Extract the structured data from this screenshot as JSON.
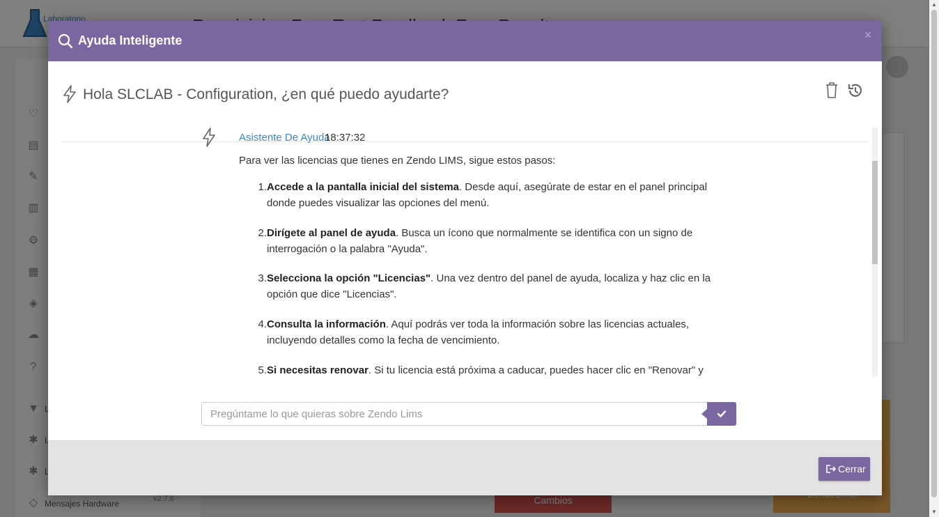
{
  "background": {
    "logo_text": "Laboratorio",
    "page_title": "Requisicion Free Test Feedback Free Result",
    "sidebar_items": [
      "L",
      "L",
      "L",
      "Mensajes Hardware"
    ],
    "version": "v2.7.6",
    "bottom_buttons": [
      "Cambios",
      "ZendoLims"
    ]
  },
  "modal": {
    "title": "Ayuda Inteligente",
    "close_glyph": "×",
    "greeting": "Hola SLCLAB - Configuration, ¿en qué puedo ayudarte?",
    "message": {
      "author": "Asistente De Ayuda",
      "time": "18:37:32",
      "intro": "Para ver las licencias que tienes en Zendo LIMS, sigue estos pasos:",
      "steps": [
        {
          "num": "1.",
          "bold": "Accede a la pantalla inicial del sistema",
          "text": ". Desde aquí, asegúrate de estar en el panel principal donde puedes visualizar las opciones del menú."
        },
        {
          "num": "2.",
          "bold": "Dirígete al panel de ayuda",
          "text": ". Busca un ícono que normalmente se identifica con un signo de interrogación o la palabra \"Ayuda\"."
        },
        {
          "num": "3.",
          "bold": "Selecciona la opción \"Licencias\"",
          "text": ". Una vez dentro del panel de ayuda, localiza y haz clic en la opción que dice \"Licencias\"."
        },
        {
          "num": "4.",
          "bold": "Consulta la información",
          "text": ". Aquí podrás ver toda la información sobre las licencias actuales, incluyendo detalles como la fecha de vencimiento."
        },
        {
          "num": "5.",
          "bold": "Si necesitas renovar",
          "text": ". Si tu licencia está próxima a caducar, puedes hacer clic en \"Renovar\" y seguir las"
        }
      ]
    },
    "input_placeholder": "Pregúntame lo que quieras sobre Zendo Lims",
    "close_button_label": "Cerrar"
  },
  "colors": {
    "accent": "#7b67a0",
    "link": "#3d87c9"
  }
}
